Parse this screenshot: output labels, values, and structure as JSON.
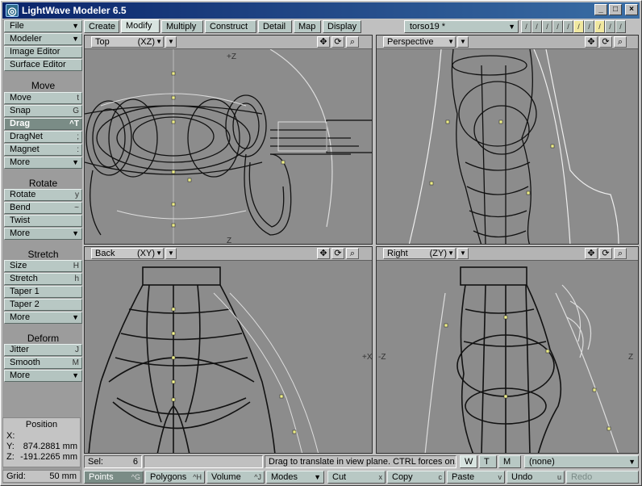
{
  "window": {
    "title": "LightWave Modeler 6.5",
    "minimize": "_",
    "maximize": "□",
    "close": "×"
  },
  "left_panel": {
    "file": "File",
    "modeler": "Modeler",
    "image_editor": "Image Editor",
    "surface_editor": "Surface Editor",
    "groups": [
      {
        "title": "Move",
        "items": [
          {
            "label": "Move",
            "shortcut": "t"
          },
          {
            "label": "Snap",
            "shortcut": "G"
          },
          {
            "label": "Drag",
            "shortcut": "^T"
          },
          {
            "label": "DragNet",
            "shortcut": ";"
          },
          {
            "label": "Magnet",
            "shortcut": ":"
          }
        ],
        "more": "More"
      },
      {
        "title": "Rotate",
        "items": [
          {
            "label": "Rotate",
            "shortcut": "y"
          },
          {
            "label": "Bend",
            "shortcut": "~"
          },
          {
            "label": "Twist",
            "shortcut": ""
          }
        ],
        "more": "More"
      },
      {
        "title": "Stretch",
        "items": [
          {
            "label": "Size",
            "shortcut": "H"
          },
          {
            "label": "Stretch",
            "shortcut": "h"
          },
          {
            "label": "Taper 1",
            "shortcut": ""
          },
          {
            "label": "Taper 2",
            "shortcut": ""
          }
        ],
        "more": "More"
      },
      {
        "title": "Deform",
        "items": [
          {
            "label": "Jitter",
            "shortcut": "J"
          },
          {
            "label": "Smooth",
            "shortcut": "M"
          }
        ],
        "more": "More"
      }
    ],
    "position": {
      "title": "Position",
      "x_label": "X:",
      "x_value": "",
      "y_label": "Y:",
      "y_value": "874.2881 mm",
      "z_label": "Z:",
      "z_value": "-191.2265 mm"
    },
    "grid": {
      "label": "Grid:",
      "value": "50 mm"
    }
  },
  "tabs": [
    "Create",
    "Modify",
    "Multiply",
    "Construct",
    "Detail",
    "Map",
    "Display"
  ],
  "active_tab": "Modify",
  "object_selector": {
    "value": "torso19 *"
  },
  "viewports": {
    "top": {
      "name": "Top",
      "axes": "(XZ)"
    },
    "perspective": {
      "name": "Perspective",
      "axes": ""
    },
    "back": {
      "name": "Back",
      "axes": "(XY)"
    },
    "right": {
      "name": "Right",
      "axes": "(ZY)"
    }
  },
  "axis_labels": {
    "z_plus": "+Z",
    "z_minus": "Z",
    "x_plus": "+X",
    "x_minus": "-Z"
  },
  "status": {
    "sel_label": "Sel:",
    "sel_value": "6",
    "message": "Drag to translate in view plane. CTRL forces on...",
    "w": "W",
    "t": "T",
    "m": "M",
    "surface": "(none)"
  },
  "bottom": {
    "points": "Points",
    "points_sc": "^G",
    "polygons": "Polygons",
    "polygons_sc": "^H",
    "volume": "Volume",
    "volume_sc": "^J",
    "modes": "Modes",
    "cut": "Cut",
    "cut_sc": "x",
    "copy": "Copy",
    "copy_sc": "c",
    "paste": "Paste",
    "paste_sc": "v",
    "undo": "Undo",
    "undo_sc": "u",
    "redo": "Redo"
  },
  "icons": {
    "move_view": "✥",
    "rotate_view": "⟳",
    "zoom_view": "🔍"
  }
}
